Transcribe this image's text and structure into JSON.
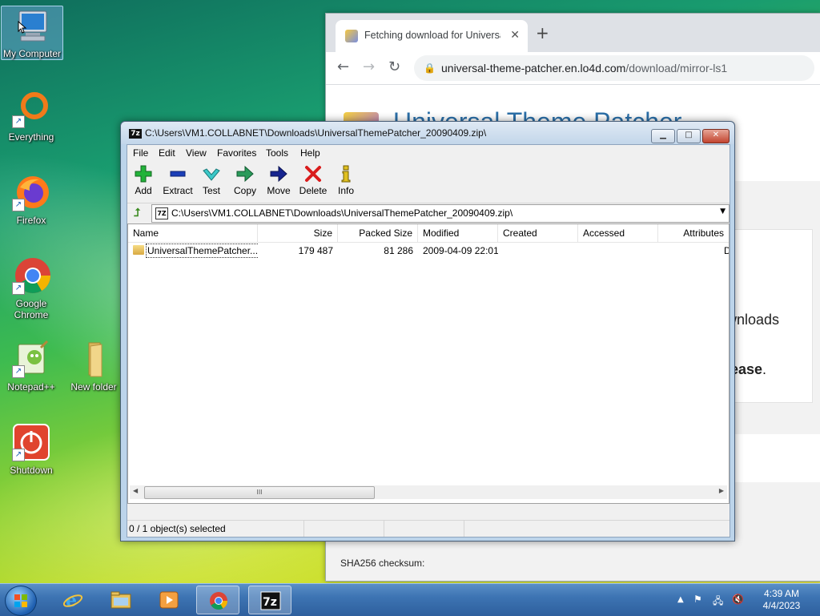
{
  "desktop": {
    "icons": [
      {
        "label": "My Computer"
      },
      {
        "label": "Everything"
      },
      {
        "label": "Firefox"
      },
      {
        "label": "Google Chrome"
      },
      {
        "label": "Notepad++"
      },
      {
        "label": "New folder"
      },
      {
        "label": "Shutdown"
      }
    ]
  },
  "browser": {
    "tab_title": "Fetching download for Universal",
    "tab_close": "✕",
    "new_tab": "+",
    "url_host": "universal-theme-patcher.en.lo4d.com",
    "url_path": "/download/mirror-ls1",
    "hero_title": "Universal Theme Patcher",
    "snippet_downloads": "wnloads",
    "snippet_please": "lease",
    "snippet_period": ".",
    "checksum_label": "SHA256 checksum:"
  },
  "zip": {
    "title": "C:\\Users\\VM1.COLLABNET\\Downloads\\UniversalThemePatcher_20090409.zip\\",
    "menu": [
      "File",
      "Edit",
      "View",
      "Favorites",
      "Tools",
      "Help"
    ],
    "toolbar": [
      "Add",
      "Extract",
      "Test",
      "Copy",
      "Move",
      "Delete",
      "Info"
    ],
    "address": "C:\\Users\\VM1.COLLABNET\\Downloads\\UniversalThemePatcher_20090409.zip\\",
    "columns": [
      "Name",
      "Size",
      "Packed Size",
      "Modified",
      "Created",
      "Accessed",
      "Attributes"
    ],
    "rows": [
      {
        "name": "UniversalThemePatcher...",
        "size": "179 487",
        "packed": "81 286",
        "modified": "2009-04-09 22:01",
        "created": "",
        "accessed": "",
        "attributes": "D"
      }
    ],
    "status": "0 / 1 object(s) selected",
    "scroll_grip": "III"
  },
  "taskbar": {
    "time": "4:39 AM",
    "date": "4/4/2023"
  },
  "colors": {
    "zip_frame": "#bcd4ea",
    "taskbar": "#3d74b3",
    "browser_link": "#2b6fa8"
  }
}
